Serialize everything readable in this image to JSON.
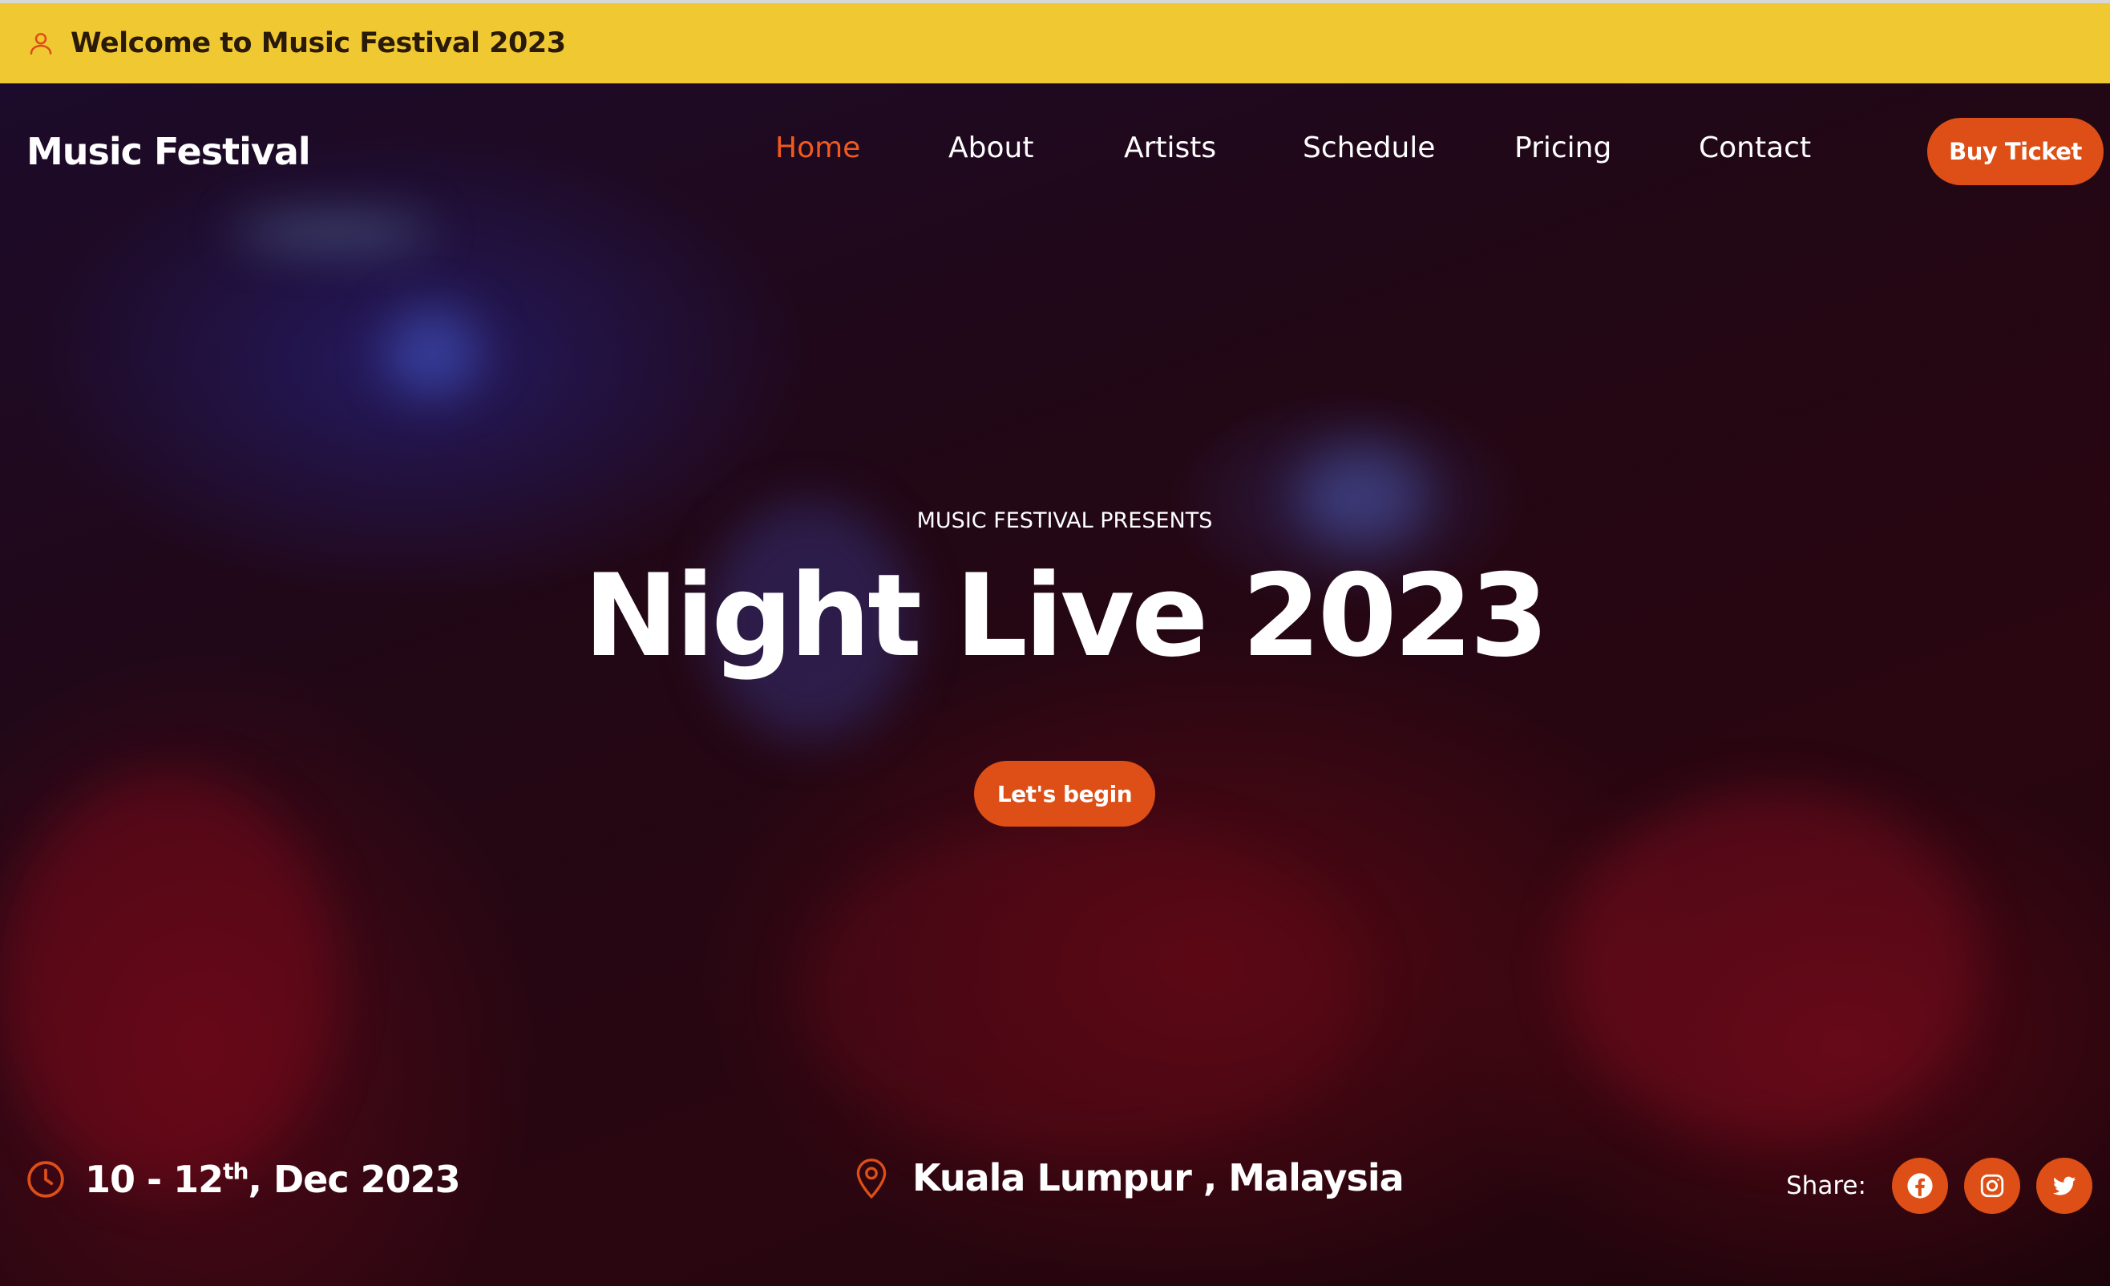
{
  "topbar": {
    "welcome": "Welcome to Music Festival 2023",
    "icon": "user-icon"
  },
  "nav": {
    "brand": "Music Festival",
    "links": [
      "Home",
      "About",
      "Artists",
      "Schedule",
      "Pricing",
      "Contact"
    ],
    "active": "Home",
    "buy_label": "Buy Ticket"
  },
  "hero": {
    "eyebrow": "MUSIC FESTIVAL PRESENTS",
    "title": "Night Live 2023",
    "cta_label": "Let's begin"
  },
  "event": {
    "date_prefix": "10 - 12",
    "date_sup": "th",
    "date_suffix": ", Dec 2023",
    "location": "Kuala Lumpur , Malaysia",
    "share_label": "Share:",
    "social": [
      "facebook-icon",
      "instagram-icon",
      "twitter-icon"
    ]
  },
  "colors": {
    "accent": "#dd4f16",
    "active_link": "#f05a1c",
    "topbar_bg": "#f0c932"
  }
}
